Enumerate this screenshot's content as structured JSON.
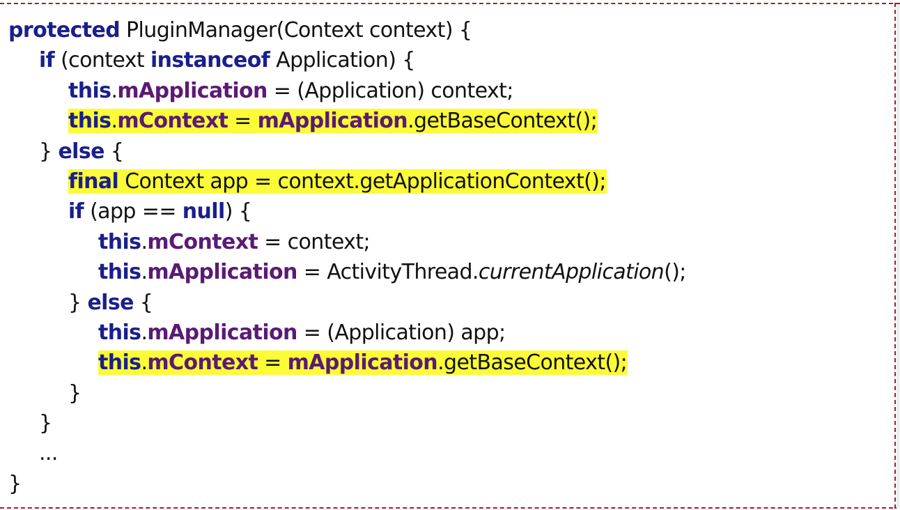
{
  "code": {
    "line1": {
      "kw": "protected",
      "rest": " PluginManager(Context context) {"
    },
    "line2": {
      "kw_if": "if",
      "t1": " (context ",
      "kw_instanceof": "instanceof",
      "t2": " Application) {"
    },
    "line3": {
      "kw_this": "this",
      "dot": ".",
      "field": "mApplication",
      "rest": " = (Application) context;"
    },
    "line4": {
      "kw_this": "this",
      "dot": ".",
      "field": "mContext",
      "eq": " = ",
      "field2": "mApplication",
      "rest": ".getBaseContext();"
    },
    "line5": {
      "brace": "} ",
      "kw_else": "else",
      "rest": " {"
    },
    "line6": {
      "kw_final": "final",
      "rest": " Context app = context.getApplicationContext();"
    },
    "line7": {
      "kw_if": "if",
      "t1": " (app == ",
      "kw_null": "null",
      "t2": ") {"
    },
    "line8": {
      "kw_this": "this",
      "dot": ".",
      "field": "mContext",
      "rest": " = context;"
    },
    "line9": {
      "kw_this": "this",
      "dot": ".",
      "field": "mApplication",
      "t1": " = ActivityThread.",
      "italic": "currentApplication",
      "t2": "();"
    },
    "line10": {
      "brace": "} ",
      "kw_else": "else",
      "rest": " {"
    },
    "line11": {
      "kw_this": "this",
      "dot": ".",
      "field": "mApplication",
      "rest": " = (Application) app;"
    },
    "line12": {
      "kw_this": "this",
      "dot": ".",
      "field": "mContext",
      "eq": " = ",
      "field2": "mApplication",
      "rest": ".getBaseContext();"
    },
    "line13": {
      "text": "}"
    },
    "line14": {
      "text": "}"
    },
    "line15": {
      "text": "..."
    },
    "line16": {
      "text": "}"
    }
  },
  "colors": {
    "keyword": "#1a1f8c",
    "field": "#5b1a74",
    "highlight": "#fbfb37",
    "border": "#a21f24"
  }
}
